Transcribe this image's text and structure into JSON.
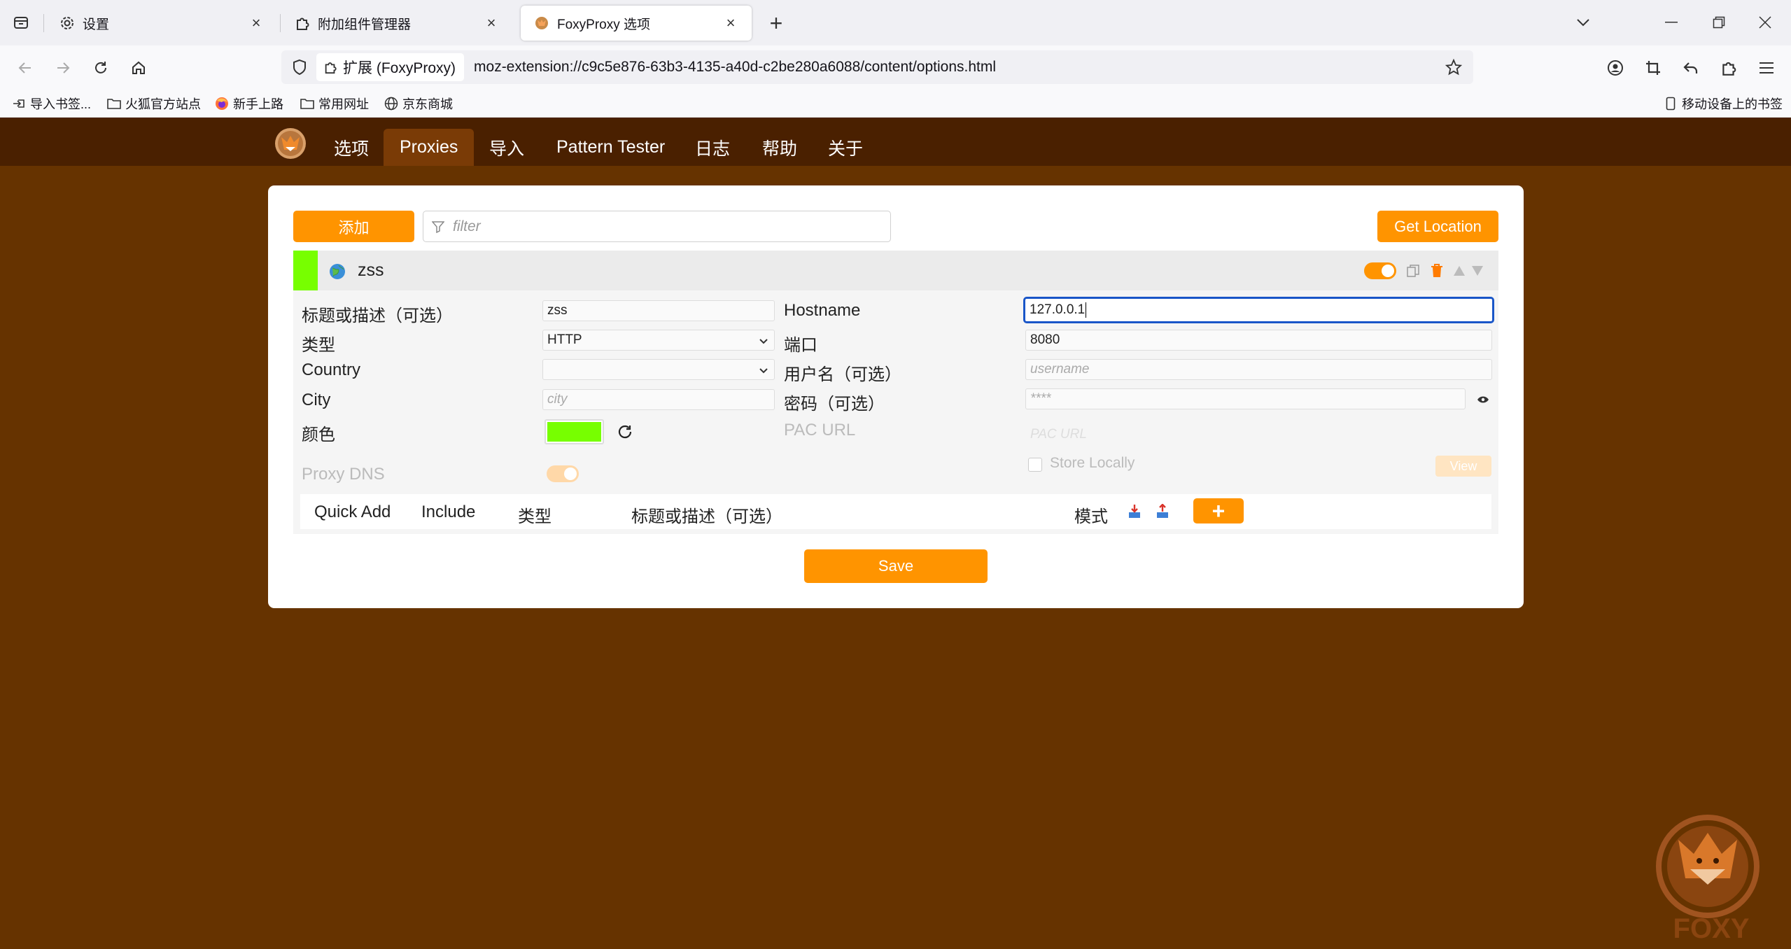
{
  "browser": {
    "tabs": [
      {
        "title": "设置",
        "icon": "gear-icon",
        "active": false
      },
      {
        "title": "附加组件管理器",
        "icon": "puzzle-icon",
        "active": false
      },
      {
        "title": "FoxyProxy 选项",
        "icon": "foxyproxy-icon",
        "active": true
      }
    ],
    "url_chip": "扩展 (FoxyProxy)",
    "url": "moz-extension://c9c5e876-63b3-4135-a40d-c2be280a6088/content/options.html",
    "bookmarks": [
      {
        "label": "导入书签...",
        "icon": "import-icon"
      },
      {
        "label": "火狐官方站点",
        "icon": "folder-icon"
      },
      {
        "label": "新手上路",
        "icon": "firefox-icon"
      },
      {
        "label": "常用网址",
        "icon": "folder-icon"
      },
      {
        "label": "京东商城",
        "icon": "globe-icon"
      }
    ],
    "mobile_bookmarks": "移动设备上的书签"
  },
  "page_nav": {
    "items": [
      "选项",
      "Proxies",
      "导入",
      "Pattern Tester",
      "日志",
      "帮助",
      "关于"
    ],
    "active": "Proxies"
  },
  "toolbar": {
    "add_label": "添加",
    "filter_placeholder": "filter",
    "get_location_label": "Get Location"
  },
  "proxy": {
    "name": "zss",
    "color": "#77ff00",
    "enabled": true,
    "fields": {
      "title_label": "标题或描述（可选）",
      "title_value": "zss",
      "type_label": "类型",
      "type_value": "HTTP",
      "country_label": "Country",
      "country_value": "",
      "city_label": "City",
      "city_placeholder": "city",
      "color_label": "颜色",
      "proxy_dns_label": "Proxy DNS",
      "hostname_label": "Hostname",
      "hostname_value": "127.0.0.1",
      "port_label": "端口",
      "port_value": "8080",
      "username_label": "用户名（可选）",
      "username_placeholder": "username",
      "password_label": "密码（可选）",
      "password_placeholder": "****",
      "pac_url_label": "PAC URL",
      "pac_url_placeholder": "PAC URL",
      "store_locally_label": "Store Locally",
      "view_label": "View"
    },
    "patterns_header": {
      "quick_add": "Quick Add",
      "include": "Include",
      "type": "类型",
      "title": "标题或描述（可选）",
      "pattern": "模式"
    }
  },
  "save_label": "Save",
  "watermark": "FOXY"
}
